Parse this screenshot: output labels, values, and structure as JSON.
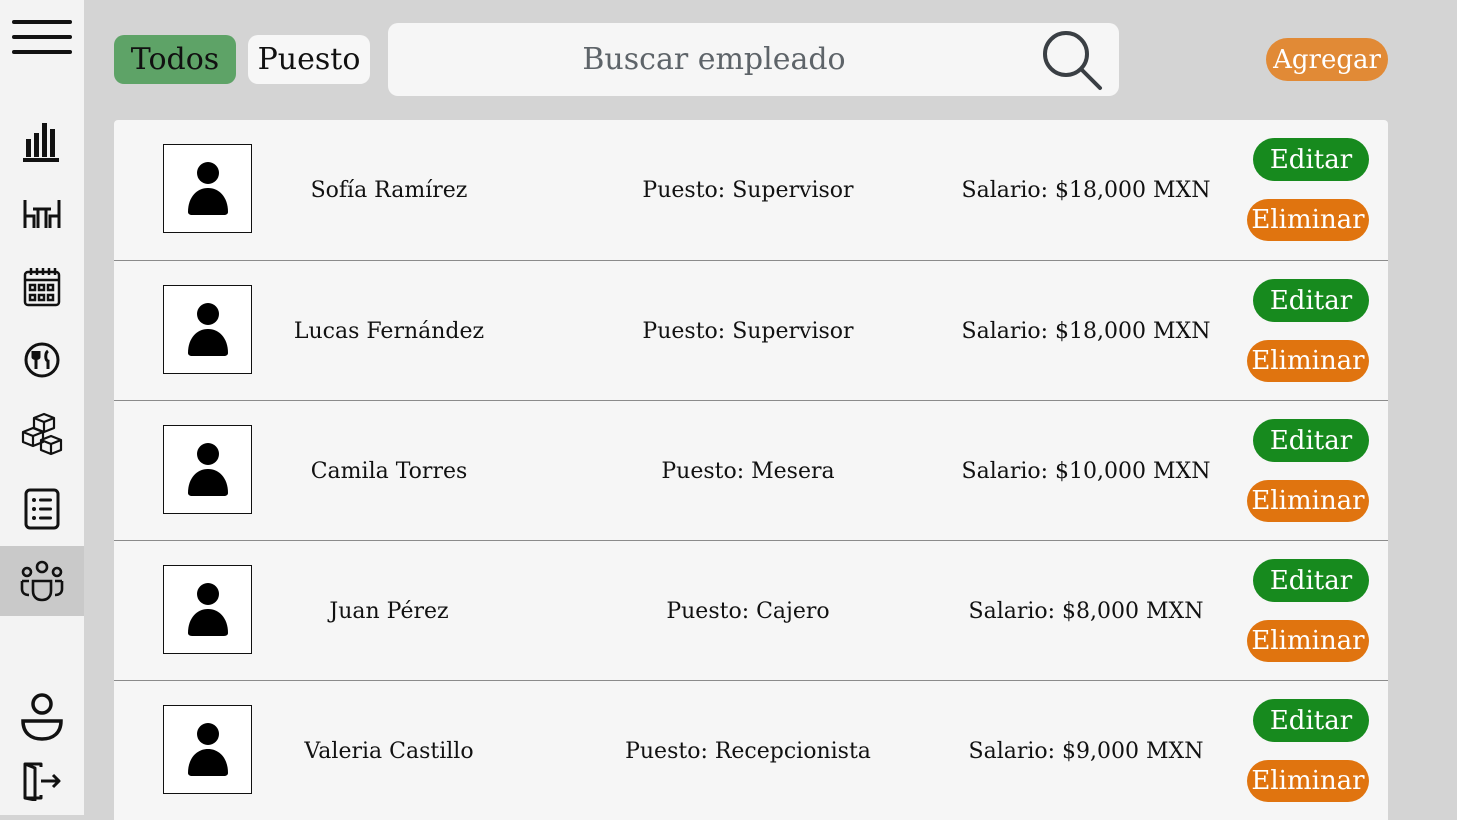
{
  "sidebar": {
    "items": [
      {
        "icon": "menu-icon"
      },
      {
        "icon": "bar-chart-icon"
      },
      {
        "icon": "tables-icon"
      },
      {
        "icon": "calendar-icon"
      },
      {
        "icon": "dish-icon"
      },
      {
        "icon": "boxes-icon"
      },
      {
        "icon": "list-icon"
      },
      {
        "icon": "employees-icon",
        "active": true
      },
      {
        "icon": "user-icon"
      },
      {
        "icon": "logout-icon"
      }
    ]
  },
  "filters": {
    "todos_label": "Todos",
    "puesto_label": "Puesto"
  },
  "search": {
    "placeholder": "Buscar empleado"
  },
  "add_label": "Agregar",
  "colors": {
    "todos_bg": "#5ea367",
    "add_bg": "#e18a36",
    "edit_bg": "#178a1e",
    "delete_bg": "#e0740f",
    "active_sidebar_bg": "#c9c9c9"
  },
  "employees": [
    {
      "name": "Sofía Ramírez",
      "position": "Puesto: Supervisor",
      "salary": "Salario: $18,000 MXN",
      "edit_label": "Editar",
      "delete_label": "Eliminar"
    },
    {
      "name": "Lucas Fernández",
      "position": "Puesto: Supervisor",
      "salary": "Salario: $18,000 MXN",
      "edit_label": "Editar",
      "delete_label": "Eliminar"
    },
    {
      "name": "Camila Torres",
      "position": "Puesto: Mesera",
      "salary": "Salario: $10,000 MXN",
      "edit_label": "Editar",
      "delete_label": "Eliminar"
    },
    {
      "name": "Juan Pérez",
      "position": "Puesto: Cajero",
      "salary": "Salario: $8,000 MXN",
      "edit_label": "Editar",
      "delete_label": "Eliminar"
    },
    {
      "name": "Valeria Castillo",
      "position": "Puesto: Recepcionista",
      "salary": "Salario: $9,000 MXN",
      "edit_label": "Editar",
      "delete_label": "Eliminar"
    }
  ]
}
